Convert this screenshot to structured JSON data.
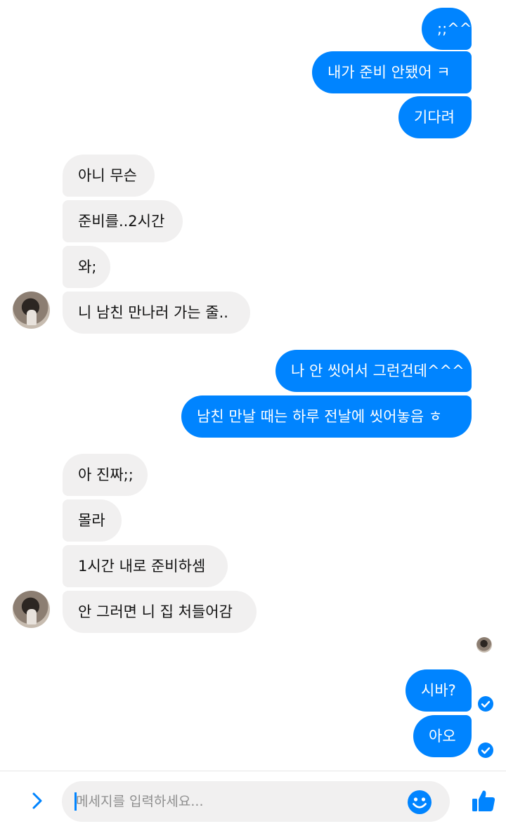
{
  "messages": [
    {
      "side": "out",
      "text": ";;^^"
    },
    {
      "side": "out",
      "text": "내가 준비 안됐어 ㅋ"
    },
    {
      "side": "out",
      "text": "기다려"
    },
    {
      "side": "in",
      "text": "아니 무슨"
    },
    {
      "side": "in",
      "text": "준비를..2시간"
    },
    {
      "side": "in",
      "text": "와;"
    },
    {
      "side": "in",
      "text": "니 남친 만나러 가는 줄.."
    },
    {
      "side": "out",
      "text": "나 안 씻어서 그런건데^^^"
    },
    {
      "side": "out",
      "text": "남친 만날 때는 하루 전날에 씻어놓음 ㅎ"
    },
    {
      "side": "in",
      "text": "아 진짜;;"
    },
    {
      "side": "in",
      "text": "몰라"
    },
    {
      "side": "in",
      "text": "1시간 내로 준비하셈"
    },
    {
      "side": "in",
      "text": "안 그러면 니 집 처들어감"
    },
    {
      "side": "out",
      "text": "시바?",
      "status": "sent"
    },
    {
      "side": "out",
      "text": "아오",
      "status": "sent"
    }
  ],
  "composer": {
    "placeholder": "메세지를 입력하세요...",
    "value": "",
    "expand_icon": "chevron-right-icon",
    "emoji_icon": "smiley-icon",
    "like_icon": "thumbs-up-icon"
  },
  "icons": {
    "sent_check": "check-circle-icon",
    "seen_avatar": "avatar"
  },
  "colors": {
    "outgoing_bubble": "#0084ff",
    "incoming_bubble": "#f1f0f0",
    "accent": "#0084ff"
  }
}
